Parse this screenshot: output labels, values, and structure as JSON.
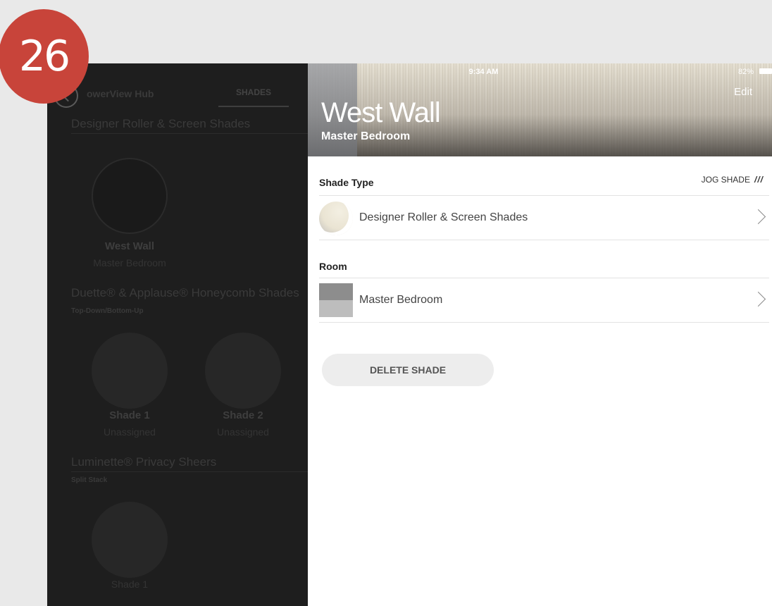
{
  "step_badge": "26",
  "background": {
    "hub_label": "owerView Hub",
    "tab_label": "SHADES",
    "groups": [
      {
        "title": "Designer Roller & Screen Shades",
        "subtitle": "",
        "items": [
          {
            "name": "West Wall",
            "room": "Master Bedroom"
          }
        ]
      },
      {
        "title": "Duette® & Applause® Honeycomb Shades",
        "subtitle": "Top-Down/Bottom-Up",
        "items": [
          {
            "name": "Shade 1",
            "room": "Unassigned"
          },
          {
            "name": "Shade 2",
            "room": "Unassigned"
          }
        ]
      },
      {
        "title": "Luminette® Privacy Sheers",
        "subtitle": "Split Stack",
        "items": [
          {
            "name": "Shade 1",
            "room": ""
          }
        ]
      }
    ]
  },
  "status_bar": {
    "time": "9:34 AM",
    "battery": "82%"
  },
  "panel": {
    "edit_label": "Edit",
    "title": "West Wall",
    "subtitle": "Master Bedroom",
    "shade_type_header": "Shade Type",
    "jog_label": "JOG SHADE",
    "jog_glyph": "///",
    "shade_type_value": "Designer Roller & Screen Shades",
    "room_header": "Room",
    "room_value": "Master Bedroom",
    "delete_label": "DELETE SHADE"
  },
  "colors": {
    "badge": "#c8443a",
    "overlay": "#1e1e1e",
    "panel": "#ffffff"
  }
}
